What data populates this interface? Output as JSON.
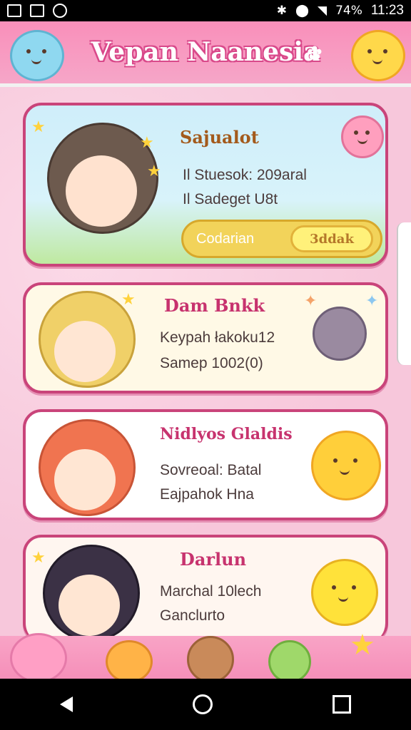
{
  "status_bar": {
    "battery": "74%",
    "time": "11:23"
  },
  "app": {
    "title": "Vepan Naanesia"
  },
  "cards": [
    {
      "title": "Sajualot",
      "lines": [
        "Il Stuesok: 209aral",
        "Il Sadeget U8t"
      ],
      "pill_label": "Codarian",
      "pill_button": "3ddak"
    },
    {
      "title": "Dam Bnkk",
      "lines": [
        "Keypah łakoku12",
        "Samep 1002(0)"
      ]
    },
    {
      "title": "Nidlyos Glaldis",
      "lines": [
        "Sovreoal: Batal",
        "Eajpahok Hna"
      ]
    },
    {
      "title": "Darlun",
      "lines": [
        "Marchal 10lech",
        "Ganclurto"
      ]
    }
  ],
  "colors": {
    "pink": "#f7c7db",
    "header": "#f98fba",
    "border": "#c9447a",
    "yellow": "#f2d35a"
  }
}
